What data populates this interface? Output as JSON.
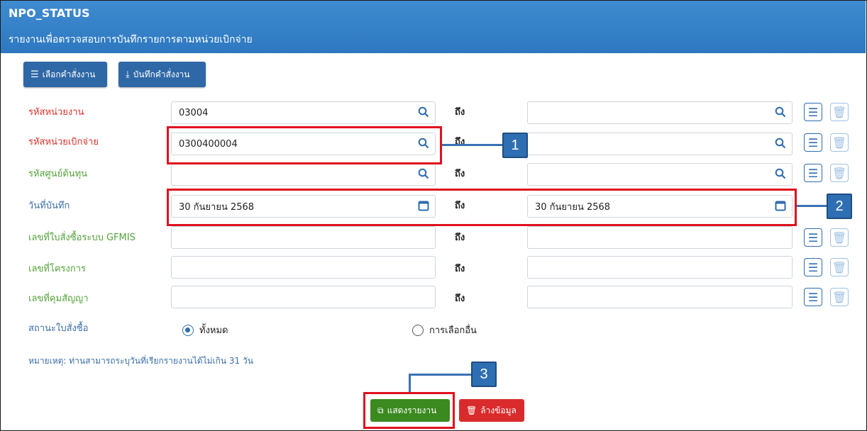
{
  "header": {
    "title": "NPO_STATUS",
    "subtitle": "รายงานเพื่อตรวจสอบการบันทึกรายการตามหน่วยเบิกจ่าย"
  },
  "toolbar": {
    "select_order_label": "เลือกคำสั่งงาน",
    "save_order_label": "บันทึกคำสั่งงาน"
  },
  "form": {
    "to_label": "ถึง",
    "rows": [
      {
        "label": "รหัสหน่วยงาน",
        "from": "03004",
        "to": ""
      },
      {
        "label": "รหัสหน่วยเบิกจ่าย",
        "from": "0300400004",
        "to": ""
      },
      {
        "label": "รหัสศูนย์ต้นทุน",
        "from": "",
        "to": ""
      },
      {
        "label": "วันที่บันทึก",
        "from": "30 กันยายน 2568",
        "to": "30 กันยายน 2568"
      },
      {
        "label": "เลขที่ใบสั่งซื้อระบบ GFMIS",
        "from": "",
        "to": ""
      },
      {
        "label": "เลขที่โครงการ",
        "from": "",
        "to": ""
      },
      {
        "label": "เลขที่คุมสัญญา",
        "from": "",
        "to": ""
      }
    ],
    "status": {
      "label": "สถานะใบสั่งซื้อ",
      "option_all": "ทั้งหมด",
      "option_other": "การเลือกอื่น",
      "selected": "ทั้งหมด"
    },
    "note": "หมายเหตุ: ท่านสามารถระบุวันที่เรียกรายงานได้ไม่เกิน 31 วัน"
  },
  "actions": {
    "show_report_label": "แสดงรายงาน",
    "clear_label": "ล้างข้อมูล"
  },
  "callouts": [
    "1",
    "2",
    "3"
  ],
  "colors": {
    "header_blue": "#2d78c0",
    "button_blue": "#2f68a6",
    "required_red": "#d9322a",
    "optional_green": "#54a33a",
    "show_green": "#3a8a1f",
    "clear_red": "#d92b2b",
    "highlight_red": "#e0111f"
  }
}
